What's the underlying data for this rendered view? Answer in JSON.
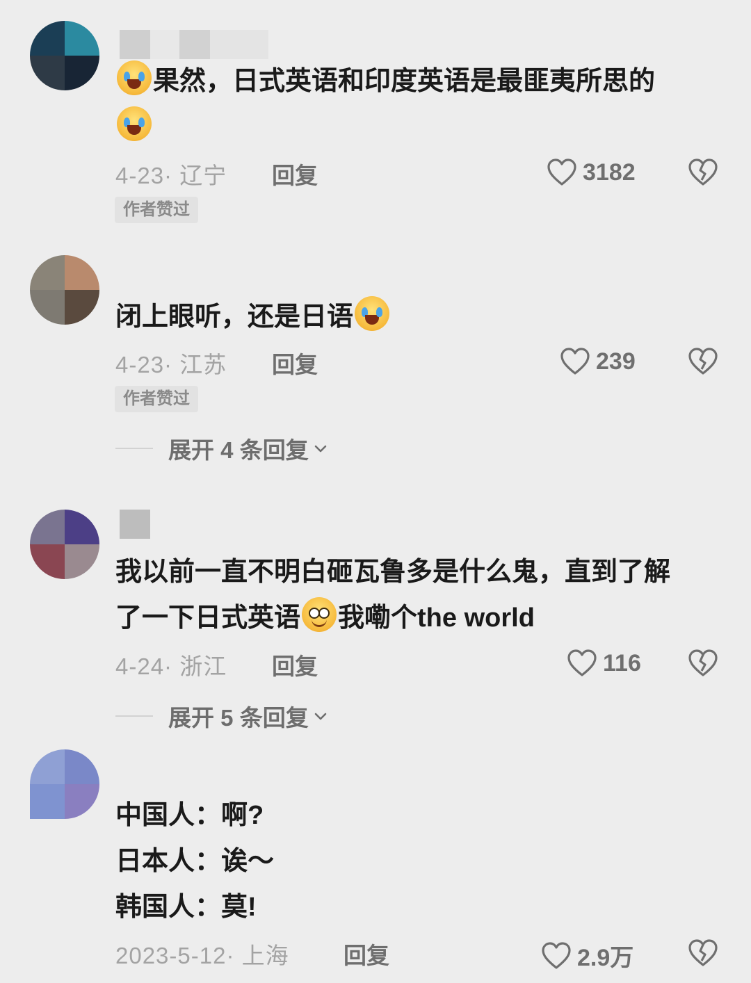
{
  "comments": [
    {
      "text_lines": [
        "果然，日式英语和印度英语是最匪夷所思的"
      ],
      "date_location": "4-23· 辽宁",
      "reply_label": "回复",
      "likes": "3182",
      "badge": "作者赞过"
    },
    {
      "text_lines": [
        "闭上眼听，还是日语"
      ],
      "date_location": "4-23· 江苏",
      "reply_label": "回复",
      "likes": "239",
      "badge": "作者赞过",
      "expand_label": "展开 4 条回复"
    },
    {
      "text_lines": [
        "我以前一直不明白砸瓦鲁多是什么鬼，直到了解",
        "了一下日式英语",
        "我嘞个the world"
      ],
      "date_location": "4-24· 浙江",
      "reply_label": "回复",
      "likes": "116",
      "expand_label": "展开 5 条回复"
    },
    {
      "text_lines": [
        "中国人：啊?",
        "日本人：诶～",
        "韩国人：莫!"
      ],
      "date_location": "2023-5-12· 上海",
      "reply_label": "回复",
      "likes": "2.9万"
    }
  ],
  "icons": {
    "like": "heart-outline-icon",
    "dislike": "broken-heart-icon",
    "expand": "chevron-down-icon",
    "emoji_cry": "laugh-cry-emoji-icon",
    "emoji_grin": "grinning-emoji-icon"
  },
  "colors": {
    "background": "#ededed",
    "text_primary": "#1a1a1a",
    "text_meta": "#a3a3a3",
    "text_action": "#6f6f6f",
    "badge_bg": "#e2e2e2"
  }
}
